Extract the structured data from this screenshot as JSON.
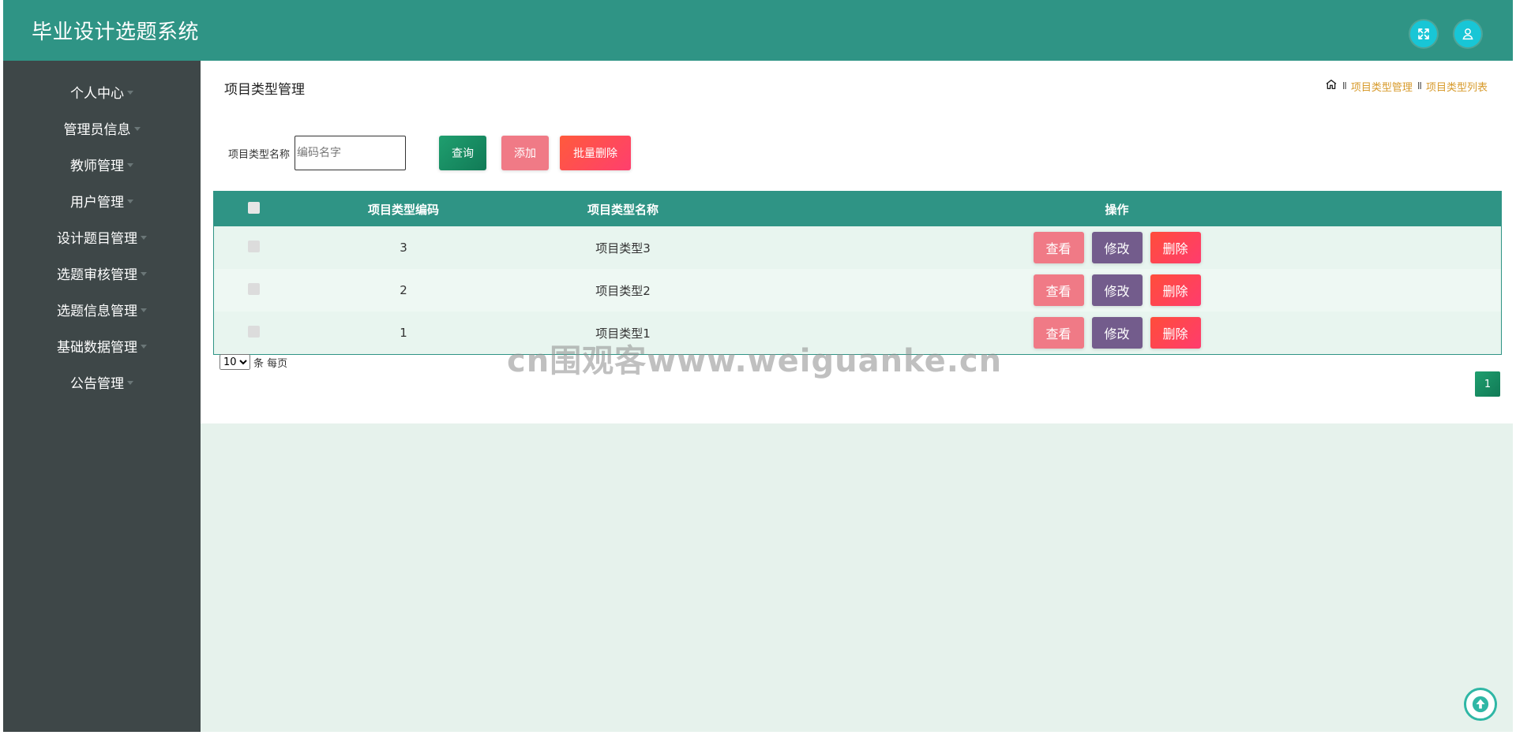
{
  "header": {
    "title": "毕业设计选题系统",
    "icons": [
      "fullscreen-icon",
      "user-icon"
    ]
  },
  "sidebar": {
    "items": [
      {
        "label": "个人中心"
      },
      {
        "label": "管理员信息"
      },
      {
        "label": "教师管理"
      },
      {
        "label": "用户管理"
      },
      {
        "label": "设计题目管理"
      },
      {
        "label": "选题审核管理"
      },
      {
        "label": "选题信息管理"
      },
      {
        "label": "基础数据管理"
      },
      {
        "label": "公告管理"
      }
    ]
  },
  "page": {
    "title": "项目类型管理",
    "breadcrumb": {
      "separator": "II",
      "items": [
        "项目类型管理",
        "项目类型列表"
      ]
    }
  },
  "search": {
    "label": "项目类型名称",
    "placeholder": "编码名字",
    "value": "",
    "query_label": "查询",
    "add_label": "添加",
    "batch_delete_label": "批量删除"
  },
  "table": {
    "columns": [
      "项目类型编码",
      "项目类型名称",
      "操作"
    ],
    "rows": [
      {
        "code": "3",
        "name": "项目类型3"
      },
      {
        "code": "2",
        "name": "项目类型2"
      },
      {
        "code": "1",
        "name": "项目类型1"
      }
    ],
    "actions": {
      "view": "查看",
      "edit": "修改",
      "delete": "删除"
    }
  },
  "pagination": {
    "page_size": "10",
    "page_size_options": [
      "10"
    ],
    "per_page_label": "条 每页",
    "current_page": "1"
  },
  "watermark": "cn围观客www.weiguanke.cn",
  "colors": {
    "primary": "#2f9485",
    "sidebar": "#3e4748",
    "accent_cyan": "#18c6d6",
    "view": "#f07a86",
    "edit": "#735c8c",
    "delete": "#ff4d5a",
    "breadcrumb": "#d79a2b"
  }
}
